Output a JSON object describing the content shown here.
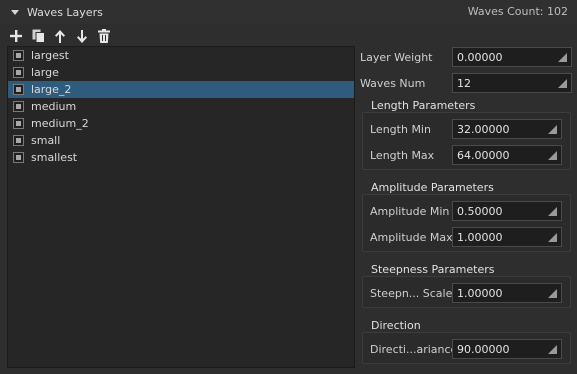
{
  "panel": {
    "title": "Waves Layers",
    "waves_count": "Waves Count: 102"
  },
  "toolbar": {
    "add_icon": "plus-icon",
    "copy_icon": "copy-icon",
    "up_icon": "arrow-up-icon",
    "down_icon": "arrow-down-icon",
    "delete_icon": "trash-icon"
  },
  "layers": [
    {
      "label": "largest"
    },
    {
      "label": "large"
    },
    {
      "label": "large_2"
    },
    {
      "label": "medium"
    },
    {
      "label": "medium_2"
    },
    {
      "label": "small"
    },
    {
      "label": "smallest"
    }
  ],
  "selected_layer": "large_2",
  "props": {
    "layer_weight_label": "Layer Weight",
    "layer_weight_value": "0.00000",
    "waves_num_label": "Waves Num",
    "waves_num_value": "12"
  },
  "length": {
    "title": "Length Parameters",
    "min_label": "Length Min",
    "min_value": "32.00000",
    "max_label": "Length Max",
    "max_value": "64.00000"
  },
  "amplitude": {
    "title": "Amplitude Parameters",
    "min_label": "Amplitude Min",
    "min_value": "0.50000",
    "max_label": "Amplitude Max",
    "max_value": "1.00000"
  },
  "steepness": {
    "title": "Steepness Parameters",
    "scale_label": "Steepn... Scale",
    "scale_value": "1.00000"
  },
  "direction": {
    "title": "Direction",
    "variance_label": "Directi...ariance",
    "variance_value": "90.00000"
  },
  "colors": {
    "background": "#2e2e2e",
    "list_background": "#262626",
    "selection": "#2f5b7d",
    "field_background": "#1e1e1e"
  }
}
